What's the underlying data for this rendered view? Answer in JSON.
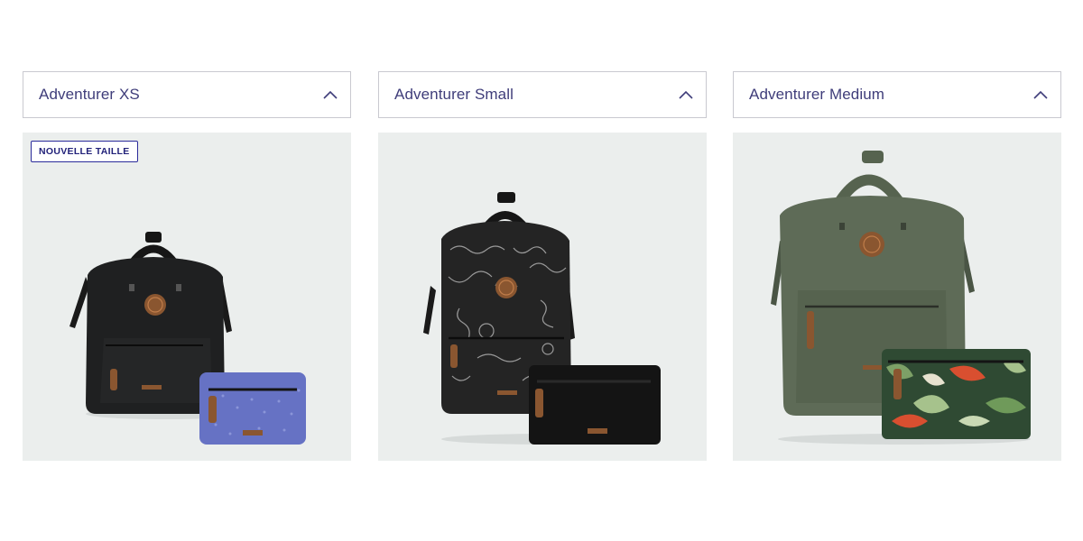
{
  "products": [
    {
      "dropdown_label": "Adventurer XS",
      "badge": "NOUVELLE TAILLE",
      "bag_color": "#1f2021",
      "pouch_color": "#6672c4"
    },
    {
      "dropdown_label": "Adventurer Small",
      "badge": "",
      "bag_color": "#242424",
      "pouch_color": "#141414"
    },
    {
      "dropdown_label": "Adventurer Medium",
      "badge": "",
      "bag_color": "#5e6b57",
      "pouch_color": "#2f4a33"
    }
  ],
  "brand_patch_text": "CABAIA"
}
